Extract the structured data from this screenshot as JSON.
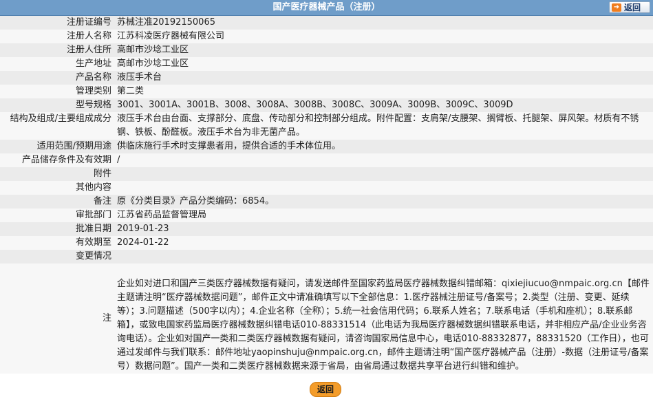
{
  "header": {
    "title": "国产医疗器械产品（注册）",
    "back_label": "返回",
    "back_icon": "back-arrow-icon"
  },
  "fields": [
    {
      "key": "注册证编号",
      "value": "苏械注准20192150065"
    },
    {
      "key": "注册人名称",
      "value": "江苏科凌医疗器械有限公司"
    },
    {
      "key": "注册人住所",
      "value": "高邮市沙埝工业区"
    },
    {
      "key": "生产地址",
      "value": "高邮市沙埝工业区"
    },
    {
      "key": "产品名称",
      "value": "液压手术台"
    },
    {
      "key": "管理类别",
      "value": "第二类"
    },
    {
      "key": "型号规格",
      "value": "3001、3001A、3001B、3008、3008A、3008B、3008C、3009A、3009B、3009C、3009D"
    },
    {
      "key": "结构及组成/主要组成成分",
      "value": "液压手术台由台面、支撑部分、底盘、传动部分和控制部分组成。附件配置：支肩架/支腰架、搁臂板、托腿架、屏风架。材质有不锈钢、铁板、酚醛板。液压手术台为非无菌产品。"
    },
    {
      "key": "适用范围/预期用途",
      "value": "供临床施行手术时支撑患者用，提供合适的手术体位用。"
    },
    {
      "key": "产品储存条件及有效期",
      "value": "/"
    },
    {
      "key": "附件",
      "value": ""
    },
    {
      "key": "其他内容",
      "value": ""
    },
    {
      "key": "备注",
      "value": "原《分类目录》产品分类编码：6854。"
    },
    {
      "key": "审批部门",
      "value": "江苏省药品监督管理局"
    },
    {
      "key": "批准日期",
      "value": "2019-01-23"
    },
    {
      "key": "有效期至",
      "value": "2024-01-22"
    },
    {
      "key": "变更情况",
      "value": ""
    }
  ],
  "note": {
    "key": "注",
    "value": "企业如对进口和国产三类医疗器械数据有疑问，请发送邮件至国家药监局医疗器械数据纠错邮箱：qixiejiucuo@nmpaic.org.cn【邮件主题请注明“医疗器械数据问题”，邮件正文中请准确填写以下全部信息：1.医疗器械注册证号/备案号；2.类型（注册、变更、延续等）；3.问题描述（500字以内）；4.企业名称（全称）；5.统一社会信用代码；6.联系人姓名；7.联系电话（手机和座机）；8.联系邮箱】，或致电国家药监局医疗器械数据纠错电话010-88331514（此电话为我局医疗器械数据纠错联系电话，并非相应产品/企业业务咨询电话）。企业如对国产一类和二类医疗器械数据有疑问，请咨询国家局信息中心，电话010-88332877，88331520（工作日），也可通过发邮件与我们联系：邮件地址yaopinshuju@nmpaic.org.cn，邮件主题请注明“国产医疗器械产品（注册）-数据（注册证号/备案号）数据问题”。国产一类和二类医疗器械数据来源于省局，由省局通过数据共享平台进行纠错和维护。"
  },
  "footer": {
    "back_label": "返回"
  }
}
